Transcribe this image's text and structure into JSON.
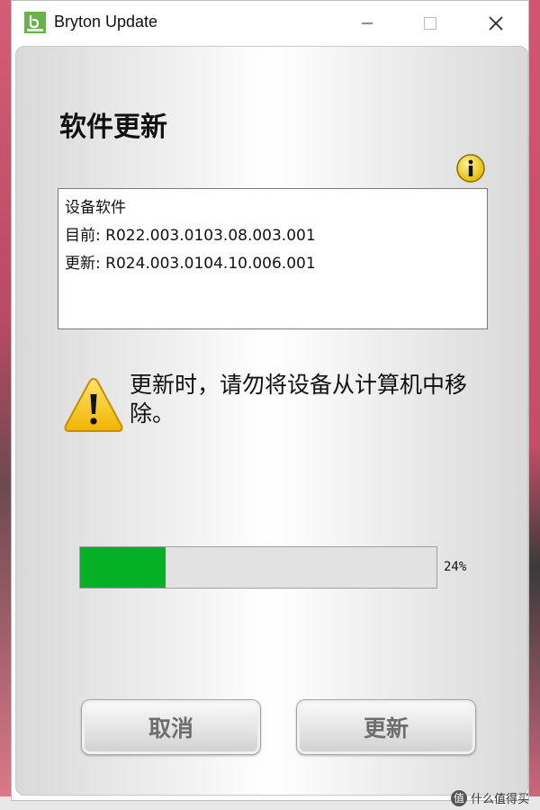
{
  "window": {
    "title": "Bryton Update"
  },
  "main": {
    "heading": "软件更新",
    "device_software_label": "设备软件",
    "current_version": "目前: R022.003.0103.08.003.001",
    "new_version": "更新: R024.003.0104.10.006.001",
    "warning": "更新时，请勿将设备从计算机中移除。"
  },
  "progress": {
    "value_percent": 24,
    "label": "24%",
    "fill_color": "#06b025"
  },
  "buttons": {
    "cancel": "取消",
    "update": "更新"
  },
  "watermark": {
    "text": "什么值得买",
    "icon": "值"
  },
  "colors": {
    "brand": "#6ab04c",
    "warning": "#f5c400",
    "info": "#f2d21b"
  },
  "icons": [
    "bryton-logo-icon",
    "minimize-icon",
    "maximize-icon",
    "close-icon",
    "info-icon",
    "warning-icon"
  ]
}
